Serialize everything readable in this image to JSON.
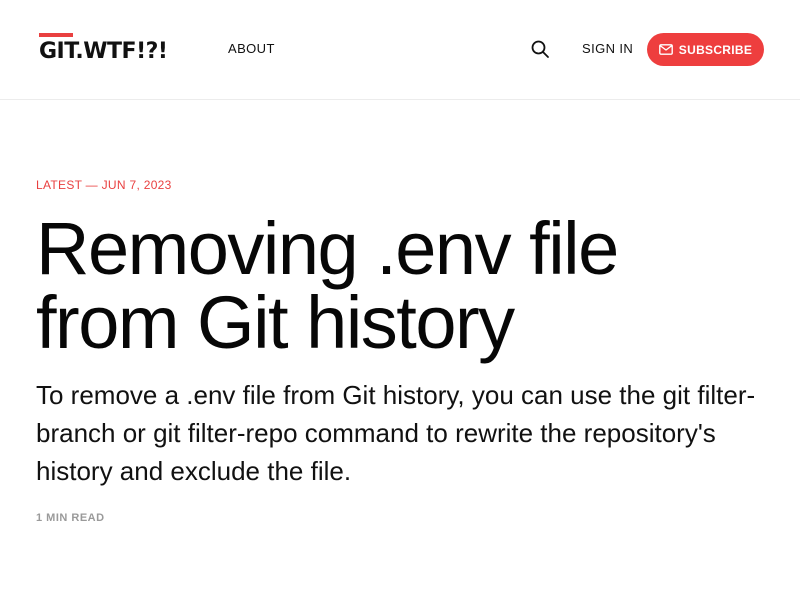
{
  "header": {
    "logo_text": "GIT.WTF!?!",
    "nav": {
      "about_label": "ABOUT"
    },
    "search_icon": "search-icon",
    "sign_in_label": "SIGN IN",
    "subscribe_label": "SUBSCRIBE",
    "subscribe_icon": "mail-icon"
  },
  "colors": {
    "accent": "#ee3e3e",
    "text": "#0c0c0c",
    "muted": "#9a9a9a",
    "divider": "#ececec"
  },
  "article": {
    "meta": "LATEST — JUN 7, 2023",
    "title": "Removing .env file from Git history",
    "excerpt": "To remove a .env file from Git history, you can use the git filter-branch or git filter-repo command to rewrite the repository's history and exclude the file.",
    "read_time": "1 MIN READ"
  }
}
